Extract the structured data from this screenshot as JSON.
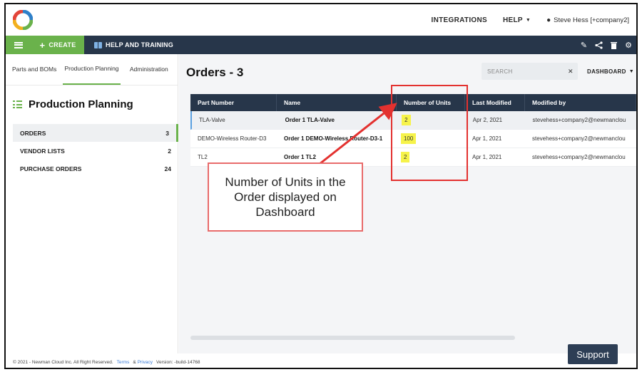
{
  "header": {
    "integrations_label": "INTEGRATIONS",
    "help_label": "HELP",
    "user_name": "Steve Hess [+company2]"
  },
  "navbar": {
    "create_label": "CREATE",
    "help_training_label": "HELP AND TRAINING"
  },
  "sidebar": {
    "tabs": [
      {
        "label": "Parts and BOMs"
      },
      {
        "label": "Production Planning"
      },
      {
        "label": "Administration"
      }
    ],
    "title": "Production Planning",
    "items": [
      {
        "label": "ORDERS",
        "count": "3"
      },
      {
        "label": "VENDOR LISTS",
        "count": "2"
      },
      {
        "label": "PURCHASE ORDERS",
        "count": "24"
      }
    ]
  },
  "main": {
    "title": "Orders - 3",
    "search_placeholder": "SEARCH",
    "dashboard_label": "DASHBOARD"
  },
  "table": {
    "columns": [
      "Part Number",
      "Name",
      "Number of Units",
      "Last Modified",
      "Modified by"
    ],
    "rows": [
      {
        "part": "TLA-Valve",
        "name": "Order 1 TLA-Valve",
        "units": "2",
        "modified": "Apr 2, 2021",
        "by": "stevehess+company2@newmanclou"
      },
      {
        "part": "DEMO-Wireless Router-D3",
        "name": "Order 1 DEMO-Wireless Router-D3-1",
        "units": "100",
        "modified": "Apr 1, 2021",
        "by": "stevehess+company2@newmanclou"
      },
      {
        "part": "TL2",
        "name": "Order 1 TL2",
        "units": "2",
        "modified": "Apr 1, 2021",
        "by": "stevehess+company2@newmanclou"
      }
    ]
  },
  "annotation": {
    "callout_text": "Number of Units in the Order displayed on Dashboard",
    "highlight_color": "#f6f34a",
    "box_color": "#e3312f"
  },
  "footer": {
    "copyright": "© 2021 - Newman Cloud Inc. All Right Reserved.",
    "terms": "Terms",
    "amp": "&",
    "privacy": "Privacy",
    "version": "Version: -build-14768",
    "support_label": "Support"
  },
  "colors": {
    "brand_green": "#6ab24b",
    "navbar": "#27364a"
  }
}
